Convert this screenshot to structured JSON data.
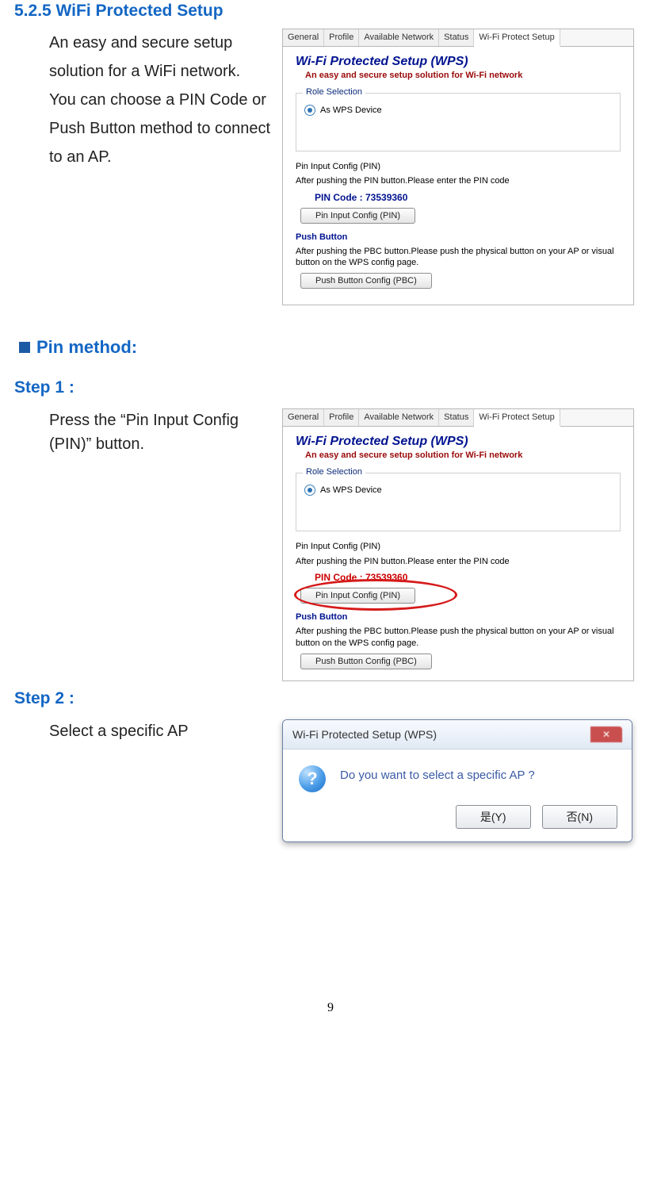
{
  "section": {
    "heading": "5.2.5 WiFi Protected Setup",
    "intro": "An easy and secure setup solution for a WiFi network. You can choose a PIN Code or Push Button method to connect to an AP."
  },
  "pin_method": {
    "title": "Pin method:"
  },
  "steps": {
    "s1": {
      "title": "Step 1 :",
      "text": "Press the “Pin Input Config (PIN)” button."
    },
    "s2": {
      "title": "Step 2 :",
      "text": "Select a specific AP"
    }
  },
  "wps_panel": {
    "tabs": [
      "General",
      "Profile",
      "Available Network",
      "Status",
      "Wi-Fi Protect Setup"
    ],
    "title": "Wi-Fi Protected Setup (WPS)",
    "subtitle": "An easy and secure setup solution for Wi-Fi network",
    "role_label": "Role Selection",
    "role_option": "As WPS Device",
    "pin_heading": "Pin Input Config (PIN)",
    "pin_desc": "After pushing the PIN button.Please enter the PIN code",
    "pin_code_label": "PIN Code :  73539360",
    "pin_button": "Pin Input Config (PIN)",
    "pb_heading": "Push Button",
    "pb_desc": "After pushing the PBC button.Please push the physical button on your AP or visual button on the WPS config page.",
    "pb_button": "Push Button Config (PBC)"
  },
  "dialog": {
    "title": "Wi-Fi Protected Setup (WPS)",
    "message": "Do you want to select a specific AP ?",
    "yes": "是(Y)",
    "no": "否(N)"
  },
  "page_number": "9"
}
